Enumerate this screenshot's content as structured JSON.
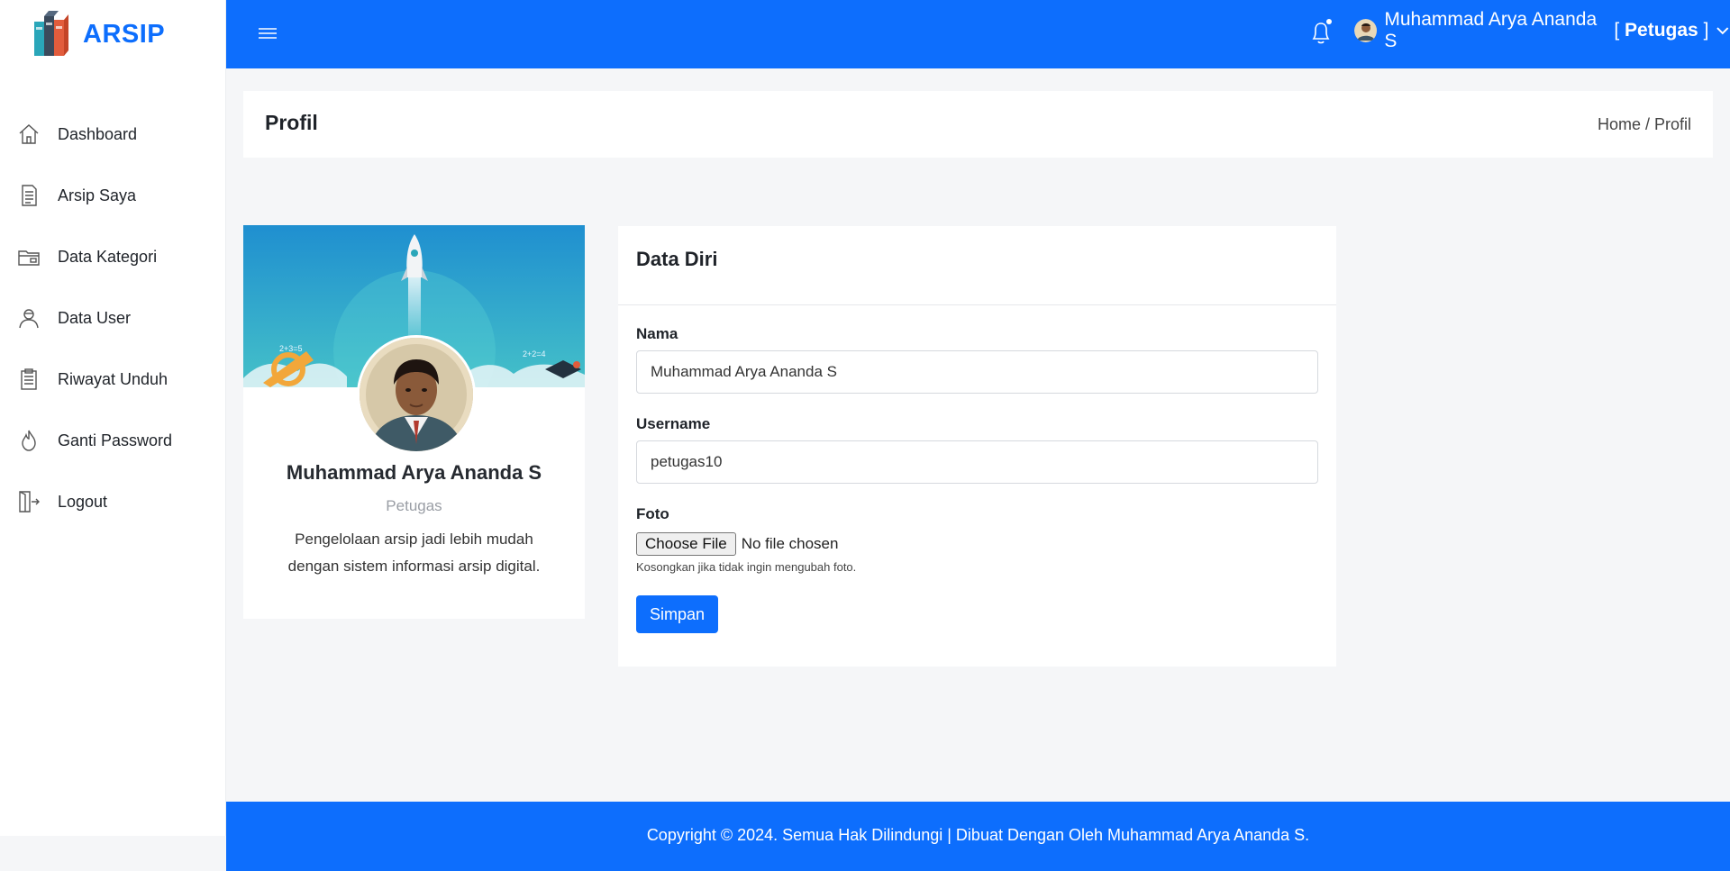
{
  "brand": {
    "name": "ARSIP",
    "accent": "#0d6efd"
  },
  "sidebar": {
    "items": [
      {
        "label": "Dashboard",
        "icon": "home-icon"
      },
      {
        "label": "Arsip Saya",
        "icon": "document-icon"
      },
      {
        "label": "Data Kategori",
        "icon": "folder-icon"
      },
      {
        "label": "Data User",
        "icon": "user-icon"
      },
      {
        "label": "Riwayat Unduh",
        "icon": "clipboard-icon"
      },
      {
        "label": "Ganti Password",
        "icon": "flame-icon"
      },
      {
        "label": "Logout",
        "icon": "logout-icon"
      }
    ]
  },
  "topbar": {
    "user_name": "Muhammad Arya Ananda S",
    "role_open": " [ ",
    "role": "Petugas",
    "role_close": " ]"
  },
  "page": {
    "title": "Profil",
    "breadcrumb_home": "Home",
    "breadcrumb_sep": " / ",
    "breadcrumb_current": "Profil"
  },
  "profile": {
    "name": "Muhammad Arya Ananda S",
    "role": "Petugas",
    "description": "Pengelolaan arsip jadi lebih mudah dengan sistem informasi arsip digital."
  },
  "form": {
    "heading": "Data Diri",
    "nama_label": "Nama",
    "nama_value": "Muhammad Arya Ananda S",
    "username_label": "Username",
    "username_value": "petugas10",
    "foto_label": "Foto",
    "choose_file": "Choose File",
    "no_file": "No file chosen",
    "help": "Kosongkan jika tidak ingin mengubah foto.",
    "submit": "Simpan"
  },
  "footer": {
    "copyright": "Copyright © 2024. Semua Hak Dilindungi | Dibuat Dengan Oleh Muhammad Arya Ananda S."
  }
}
